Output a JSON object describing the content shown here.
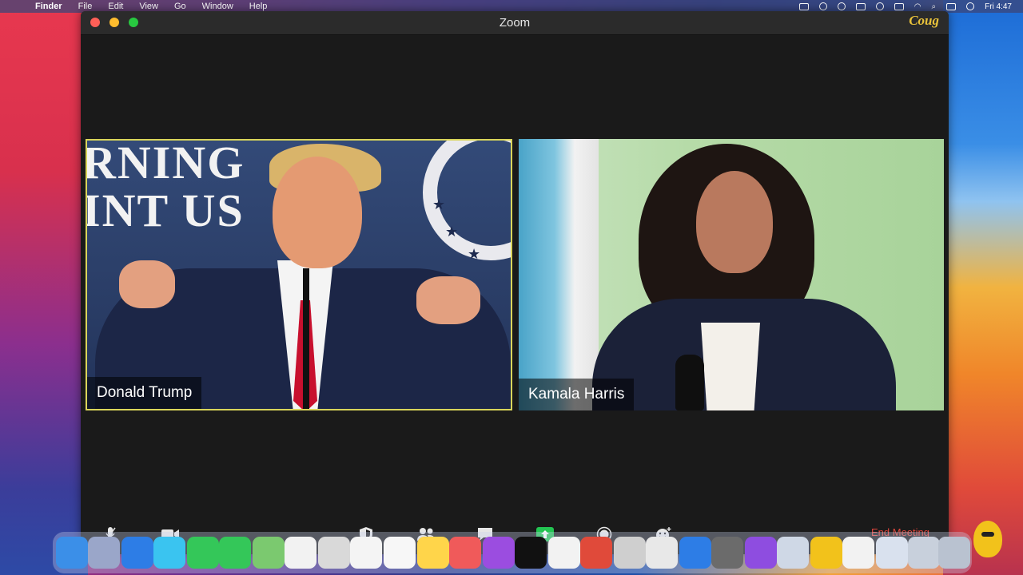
{
  "menubar": {
    "app_name": "Finder",
    "menus": [
      "File",
      "Edit",
      "View",
      "Go",
      "Window",
      "Help"
    ],
    "clock": "Fri 4:47"
  },
  "window": {
    "title": "Zoom",
    "brand_watermark": "Cougar"
  },
  "participants": [
    {
      "name": "Donald Trump",
      "active_speaker": true,
      "banner_text": [
        "RNING",
        "INT US"
      ]
    },
    {
      "name": "Kamala Harris",
      "active_speaker": false
    }
  ],
  "toolbar": {
    "icons": [
      "microphone-icon",
      "video-camera-icon",
      "security-shield-icon",
      "participants-icon",
      "chat-icon",
      "share-screen-icon",
      "record-icon",
      "reactions-icon"
    ],
    "end_meeting_label": "End Meeting"
  },
  "colors": {
    "active_speaker_border": "#d9d55a",
    "share_screen_green": "#23c552",
    "end_meeting_red": "#e0463c"
  }
}
